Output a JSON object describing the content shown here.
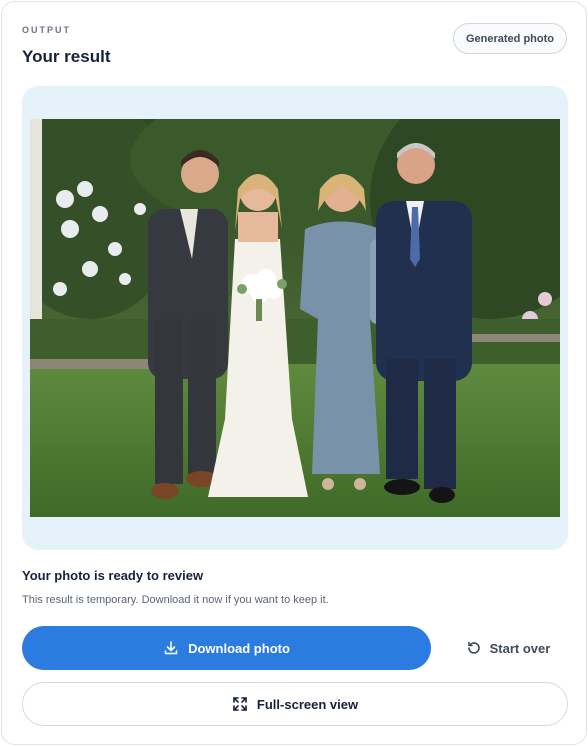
{
  "header": {
    "eyebrow": "OUTPUT",
    "title": "Your result",
    "chip_label": "Generated photo"
  },
  "photo": {
    "alt": "Generated family photo: groom, bride, mother and father standing on a lawn in a garden"
  },
  "status": {
    "title": "Your photo is ready to review",
    "subtitle": "This result is temporary. Download it now if you want to keep it."
  },
  "actions": {
    "download_label": "Download photo",
    "download_icon": "download-icon",
    "start_over_label": "Start over",
    "start_over_icon": "restart-icon",
    "fullscreen_label": "Full-screen view",
    "fullscreen_icon": "expand-icon"
  },
  "colors": {
    "accent": "#2c7be0",
    "panel_bg": "#e6f2f9",
    "text_dark": "#15233a"
  }
}
